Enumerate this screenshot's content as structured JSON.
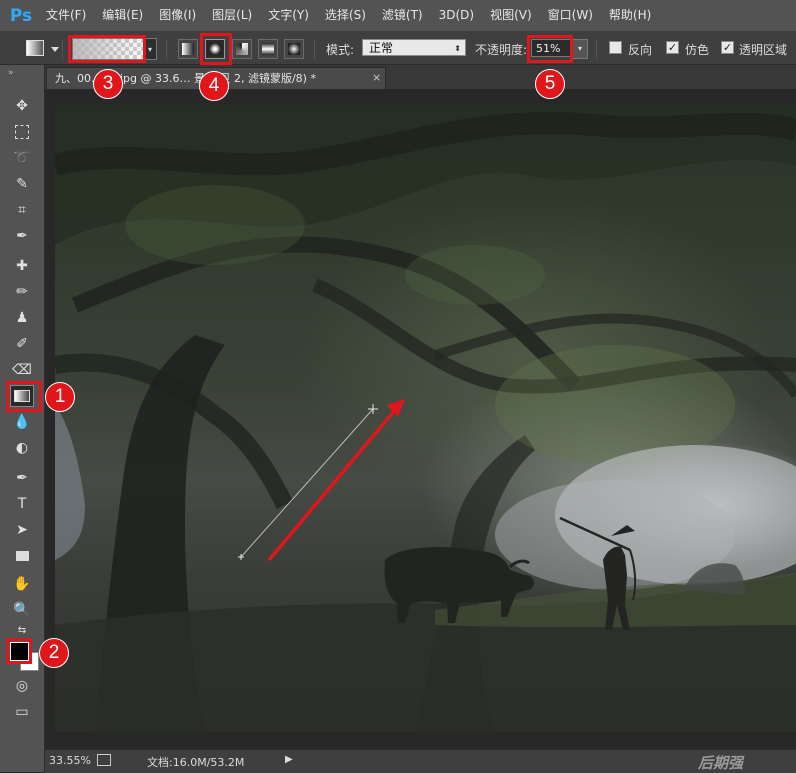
{
  "app": {
    "logo": "Ps"
  },
  "menu": [
    "文件(F)",
    "编辑(E)",
    "图像(I)",
    "图层(L)",
    "文字(Y)",
    "选择(S)",
    "滤镜(T)",
    "3D(D)",
    "视图(V)",
    "窗口(W)",
    "帮助(H)"
  ],
  "options": {
    "mode_label": "模式:",
    "mode_value": "正常",
    "opacity_label": "不透明度:",
    "opacity_value": "51%",
    "reverse_label": "反向",
    "dither_label": "仿色",
    "transparency_label": "透明区域",
    "reverse_checked": false,
    "dither_checked": true,
    "transparency_checked": true,
    "selected_gradient_type": "radial"
  },
  "document": {
    "tab_title": "九、00… 图.jpg @ 33.6… 景 拷贝 2, 滤镜蒙版/8) *",
    "close": "×"
  },
  "status": {
    "zoom": "33.55%",
    "doc_info": "文档:16.0M/53.2M",
    "arrow": "▶"
  },
  "watermark": "后期强",
  "annotations": [
    {
      "label": "1",
      "target": "gradient-tool"
    },
    {
      "label": "2",
      "target": "color-swatches"
    },
    {
      "label": "3",
      "target": "gradient-picker"
    },
    {
      "label": "4",
      "target": "radial-gradient-type"
    },
    {
      "label": "5",
      "target": "opacity-field"
    }
  ],
  "colors": {
    "annotation_red": "#e0161b",
    "ps_blue": "#31a8ff",
    "ui_dark": "#535353"
  }
}
